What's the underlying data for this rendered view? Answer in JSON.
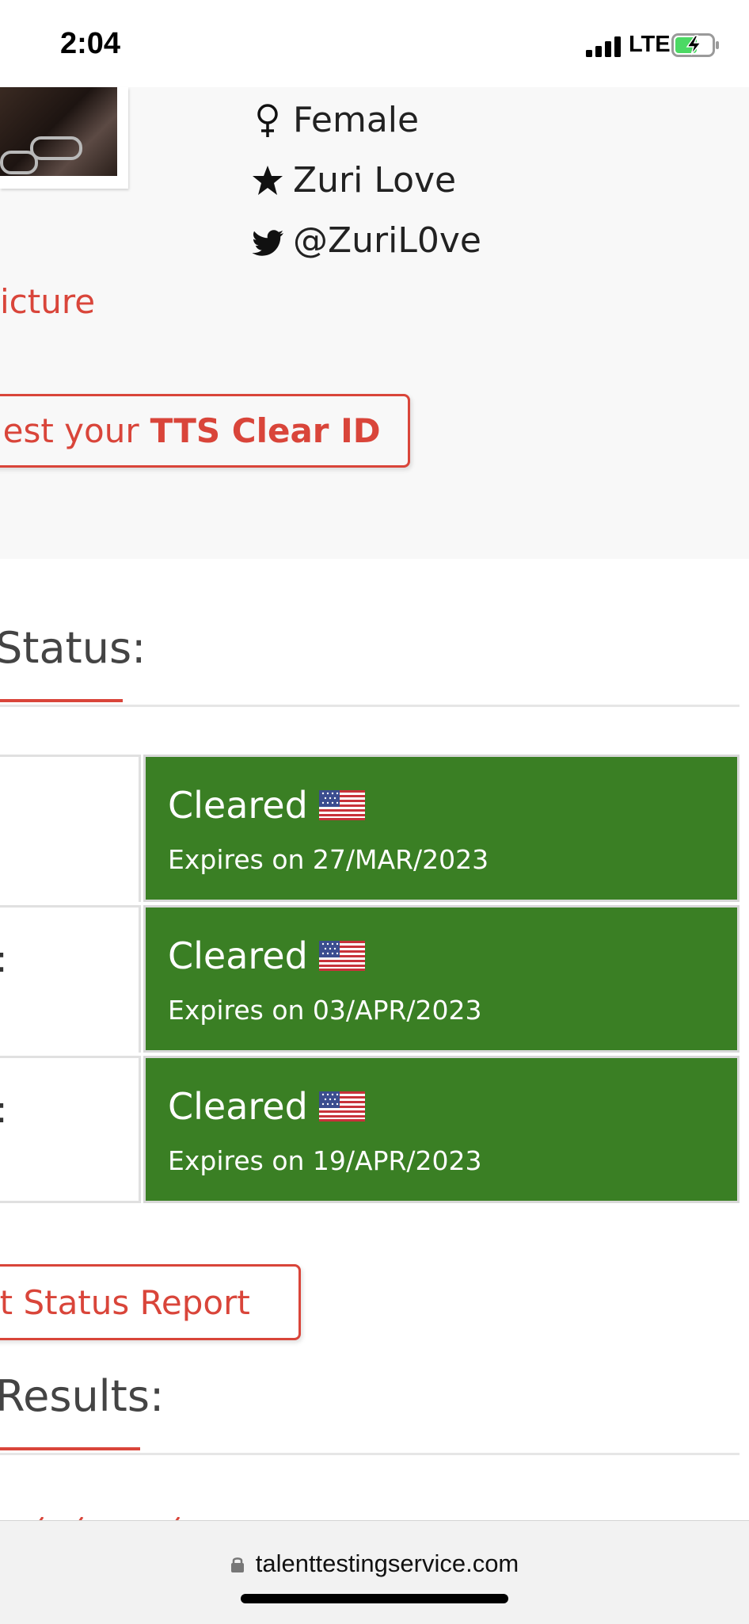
{
  "status_bar": {
    "time": "2:04",
    "network": "LTE"
  },
  "profile": {
    "gender": "Female",
    "stage_name": "Zuri Love",
    "twitter": "@ZuriL0ve",
    "picture_link": "icture",
    "tts_button": {
      "prefix": "uest your",
      "bold": "TTS Clear ID"
    }
  },
  "status_section": {
    "title": "Status:",
    "rows": [
      {
        "left_fragment": "",
        "status": "Cleared",
        "flag": "us-flag-icon",
        "expires": "Expires on 27/MAR/2023"
      },
      {
        "left_fragment": ":",
        "status": "Cleared",
        "flag": "us-flag-icon",
        "expires": "Expires on 03/APR/2023"
      },
      {
        "left_fragment": ":",
        "status": "Cleared",
        "flag": "us-flag-icon",
        "expires": "Expires on 19/APR/2023"
      }
    ],
    "report_button": "nt Status Report"
  },
  "results_section": {
    "title": "Results:"
  },
  "browser": {
    "url": "talenttestingservice.com"
  },
  "colors": {
    "accent": "#d9453a",
    "cleared_green": "#3a7f24",
    "profile_bg": "#f8f8f8"
  }
}
